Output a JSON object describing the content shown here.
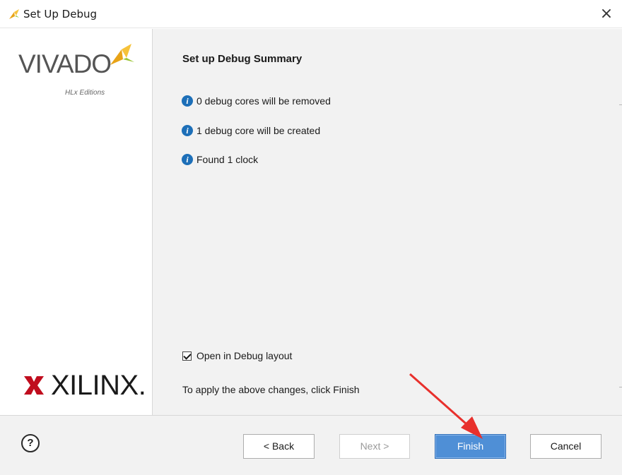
{
  "window": {
    "title": "Set Up Debug",
    "close_symbol": "×",
    "icon": "vivado-leaf-icon"
  },
  "sidebar": {
    "vivado_wordmark": "VIVADO",
    "vivado_subtitle": "HLx Editions",
    "xilinx_wordmark": "XILINX."
  },
  "main": {
    "heading": "Set up Debug Summary",
    "info_items": [
      "0 debug cores will be removed",
      "1 debug core will be created",
      "Found 1 clock"
    ],
    "open_layout_checkbox": {
      "label": "Open in Debug layout",
      "checked": true
    },
    "apply_hint": "To apply the above changes, click Finish"
  },
  "footer": {
    "help_label": "?",
    "back_label": "< Back",
    "next_label": "Next >",
    "finish_label": "Finish",
    "cancel_label": "Cancel"
  },
  "colors": {
    "accent": "#4f8fd6",
    "info_icon": "#1d6fb8",
    "annotation_arrow": "#e8302c",
    "panel_bg": "#f2f2f2"
  }
}
